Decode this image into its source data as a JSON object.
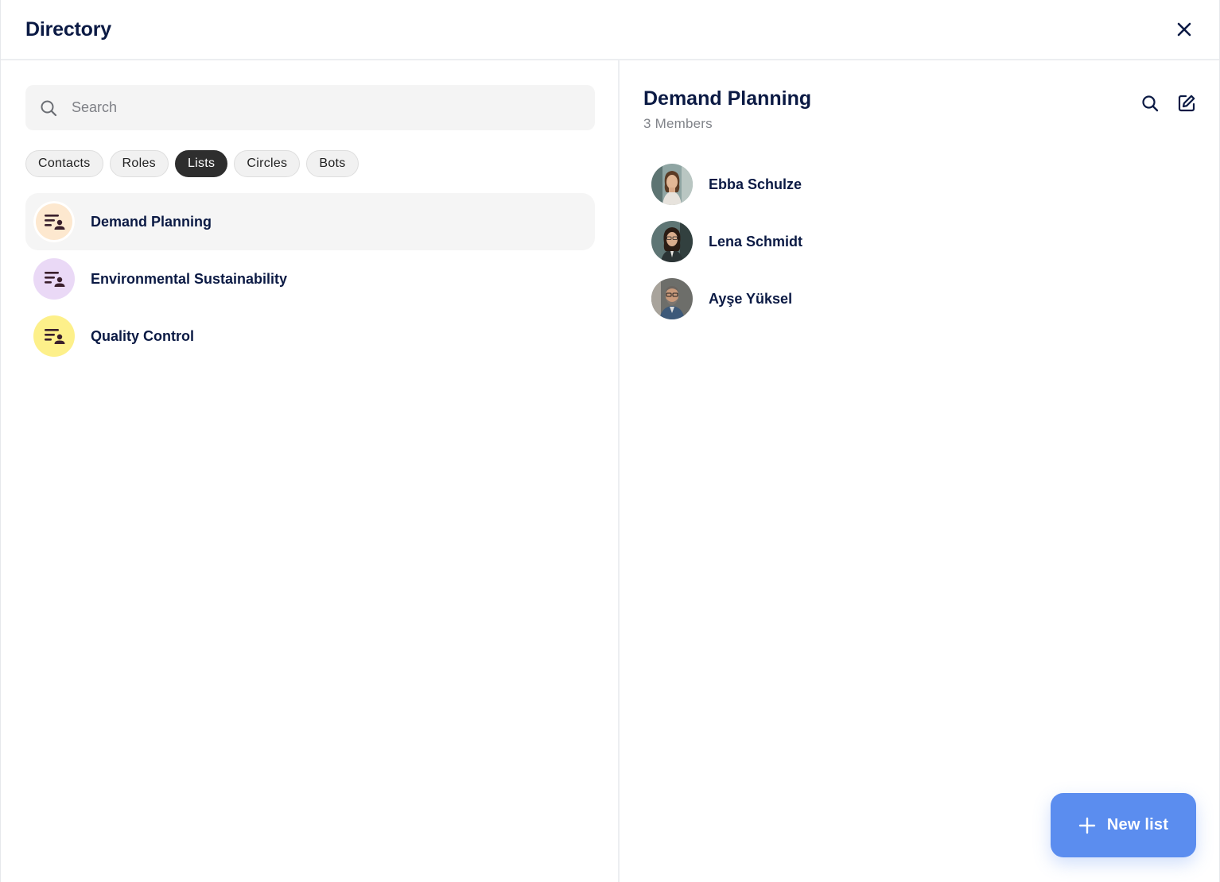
{
  "header": {
    "title": "Directory"
  },
  "search": {
    "placeholder": "Search"
  },
  "filters": [
    {
      "label": "Contacts",
      "active": false
    },
    {
      "label": "Roles",
      "active": false
    },
    {
      "label": "Lists",
      "active": true
    },
    {
      "label": "Circles",
      "active": false
    },
    {
      "label": "Bots",
      "active": false
    }
  ],
  "lists": [
    {
      "label": "Demand Planning",
      "icon": "list-person-icon",
      "color": "#fde8cf",
      "selected": true
    },
    {
      "label": "Environmental Sustainability",
      "icon": "list-person-icon",
      "color": "#ead9f6",
      "selected": false
    },
    {
      "label": "Quality Control",
      "icon": "list-person-icon",
      "color": "#fdf08a",
      "selected": false
    }
  ],
  "detail": {
    "title": "Demand Planning",
    "subtitle": "3 Members",
    "members": [
      {
        "name": "Ebba Schulze",
        "avatar": "avatar-photo"
      },
      {
        "name": "Lena Schmidt",
        "avatar": "avatar-photo"
      },
      {
        "name": "Ayşe Yüksel",
        "avatar": "avatar-photo"
      }
    ]
  },
  "fab": {
    "label": "New list",
    "color": "#5b8def"
  },
  "colors": {
    "text": "#0b1a44",
    "muted": "#808389",
    "chip_active": "#2e2e2e"
  }
}
